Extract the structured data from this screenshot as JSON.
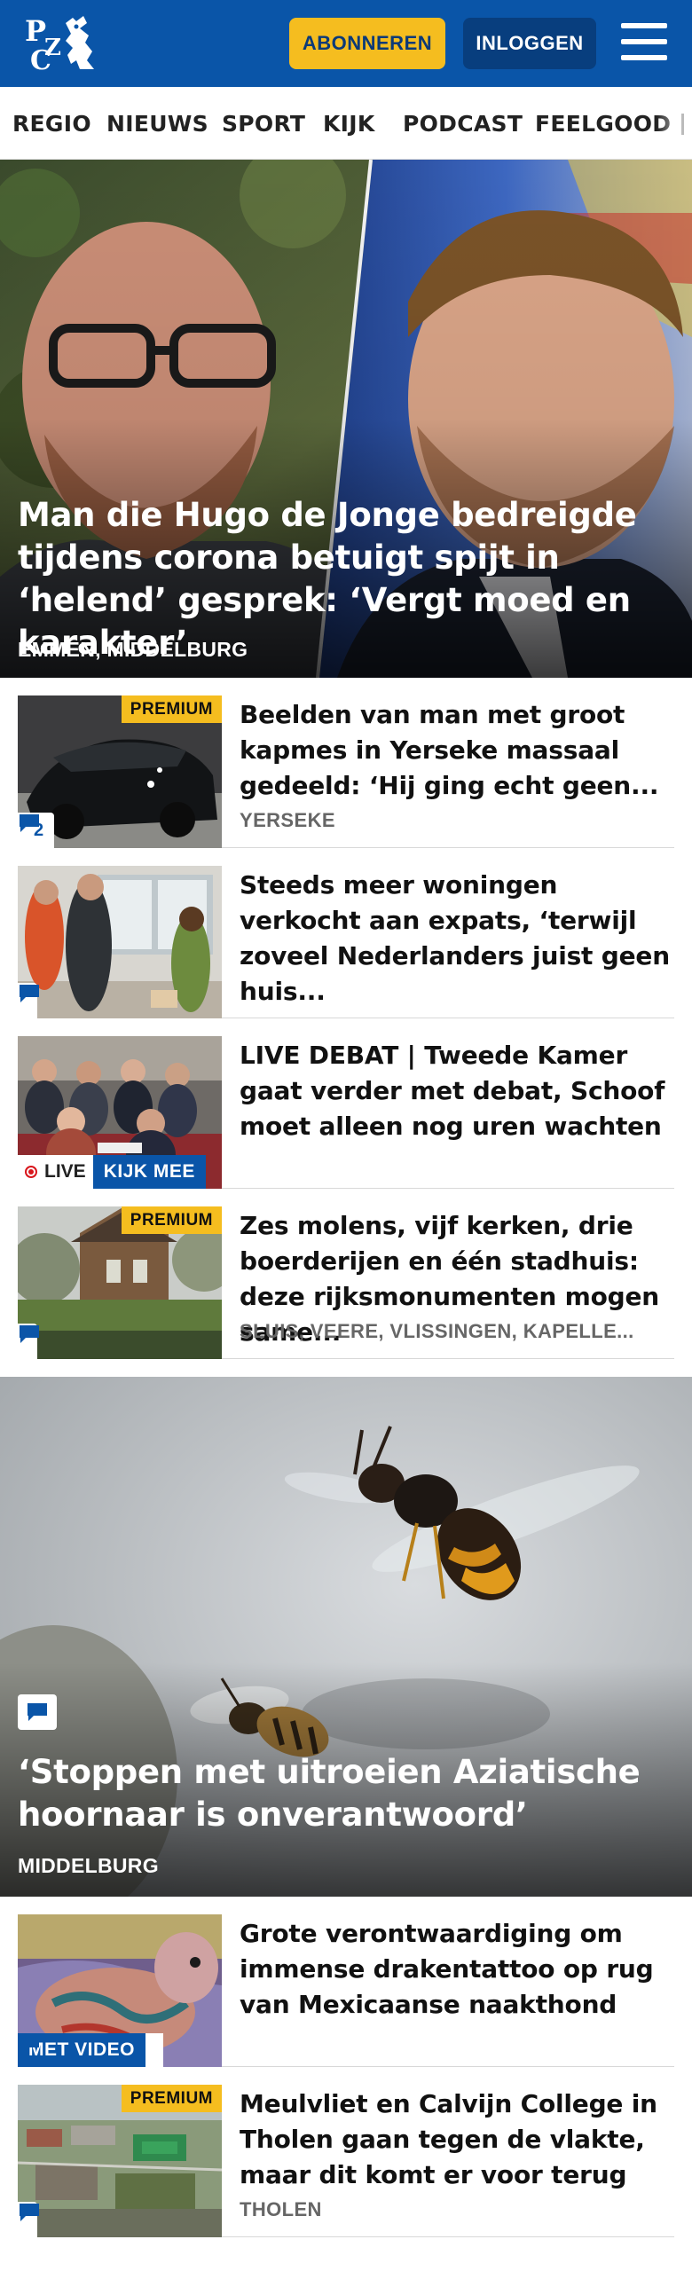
{
  "header": {
    "logo_text": "PZC",
    "subscribe_label": "ABONNEREN",
    "login_label": "INLOGGEN",
    "brand_color": "#0a55a8",
    "accent_color": "#f5bd1f"
  },
  "nav": {
    "items": [
      "REGIO",
      "NIEUWS",
      "SPORT",
      "KIJK",
      "PODCAST",
      "FEELGOOD"
    ]
  },
  "hero1": {
    "title": "Man die Hugo de Jonge bedreigde tijdens corona betuigt spijt in ‘helend’ gesprek: ‘Vergt moed en karakter’",
    "location": "EMMEN, MIDDELBURG"
  },
  "articles": [
    {
      "title": "Beelden van man met groot kapmes in Yerseke massaal gedeeld: ‘Hij ging echt geen...",
      "location": "YERSEKE",
      "badge": "PREMIUM",
      "comments": "2"
    },
    {
      "title": "Steeds meer woningen verkocht aan expats, ‘terwijl zoveel Nederlanders juist geen huis...",
      "location": ""
    },
    {
      "title": "LIVE DEBAT | Tweede Kamer gaat verder met debat, Schoof moet alleen nog uren wachten",
      "live_label": "LIVE",
      "watch_label": "KIJK MEE"
    },
    {
      "title": "Zes molens, vijf kerken, drie boerderijen en één stadhuis: deze rijksmonumenten mogen same...",
      "location": "SLUIS, VEERE, VLISSINGEN, KAPELLE...",
      "badge": "PREMIUM"
    }
  ],
  "hero2": {
    "title": "‘Stoppen met uitroeien Aziatische hoornaar is onverantwoord’",
    "location": "MIDDELBURG"
  },
  "articles2": [
    {
      "title": "Grote verontwaardiging om immense drakentattoo op rug van Mexicaanse naakthond",
      "video_label": "MET VIDEO"
    },
    {
      "title": "Meulvliet en Calvijn College in Tholen gaan tegen de vlakte, maar dit komt er voor terug",
      "location": "THOLEN",
      "badge": "PREMIUM"
    }
  ]
}
